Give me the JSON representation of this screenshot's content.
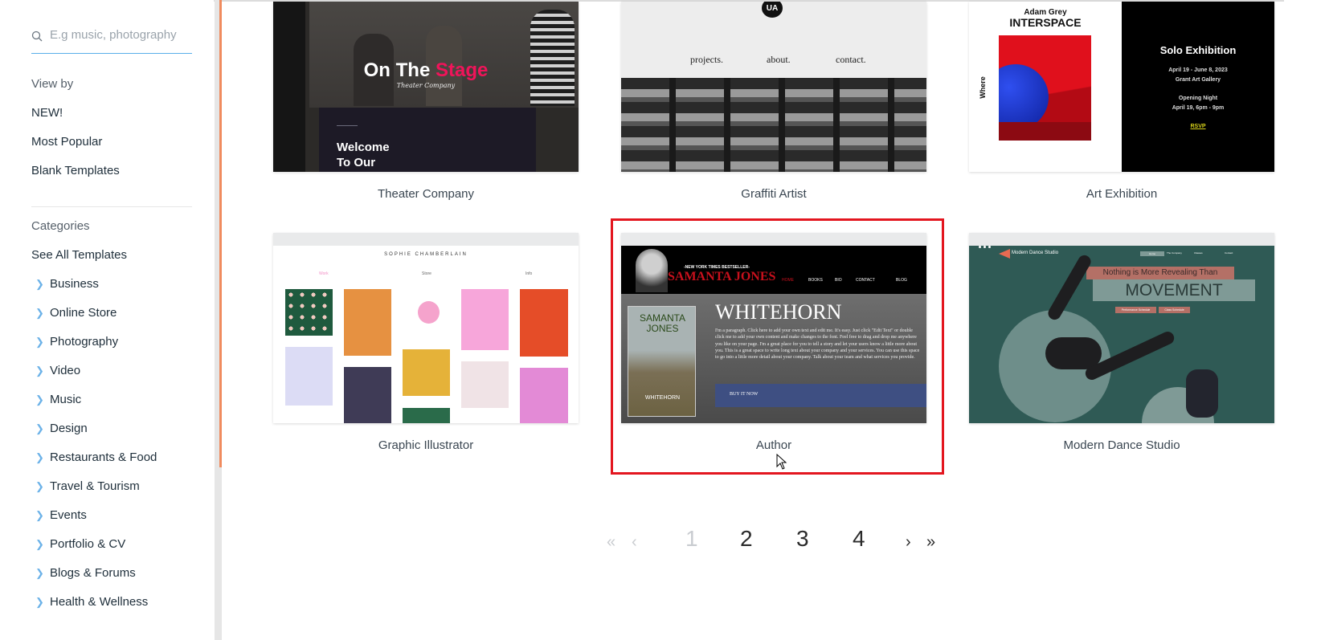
{
  "sidebar": {
    "search_placeholder": "E.g music, photography",
    "view_by_label": "View by",
    "view_by_links": [
      "NEW!",
      "Most Popular",
      "Blank Templates"
    ],
    "categories_label": "Categories",
    "see_all": "See All Templates",
    "categories": [
      "Business",
      "Online Store",
      "Photography",
      "Video",
      "Music",
      "Design",
      "Restaurants & Food",
      "Travel & Tourism",
      "Events",
      "Portfolio & CV",
      "Blogs & Forums",
      "Health & Wellness"
    ]
  },
  "templates": [
    {
      "label": "Theater Company",
      "preview": {
        "title_white": "On The",
        "title_accent": "Stage",
        "subtitle": "Theater Company",
        "welcome": "Welcome\nTo Our"
      }
    },
    {
      "label": "Graffiti Artist",
      "preview": {
        "logo": "UA",
        "nav": [
          "projects.",
          "about.",
          "contact."
        ]
      }
    },
    {
      "label": "Art Exhibition",
      "preview": {
        "artist": "Adam Grey",
        "work": "INTERSPACE",
        "side": "Where",
        "heading": "Solo Exhibition",
        "dates": "April 19 - June 8, 2023",
        "venue": "Grant Art Gallery",
        "opening": "Opening Night",
        "opening_time": "April 19, 6pm - 9pm",
        "rsvp": "RSVP"
      }
    },
    {
      "label": "Graphic Illustrator",
      "preview": {
        "name": "SOPHIE CHAMBERLAIN",
        "nav": [
          "Work",
          "Store",
          "Info"
        ]
      }
    },
    {
      "label": "Author",
      "preview": {
        "tagline": "-NEW YORK TIMES BESTSELLER-",
        "name": "SAMANTA JONES",
        "nav": [
          "HOME",
          "BOOKS",
          "BIO",
          "CONTACT",
          "BLOG"
        ],
        "book_author": "SAMANTA JONES",
        "book_title": "WHITEHORN",
        "heading": "WHITEHORN",
        "paragraph": "I'm a paragraph. Click here to add your own text and edit me. It's easy. Just click \"Edit Text\" or double click me to add your own content and make changes to the font. Feel free to drag and drop me anywhere you like on your page. I'm a great place for you to tell a story and let your users know a little more about you. This is a great space to write long text about your company and your services. You can use this space to go into a little more detail about your company. Talk about your team and what services you provide.",
        "cta": "BUY IT NOW"
      }
    },
    {
      "label": "Modern Dance Studio",
      "preview": {
        "brand": "Modern Dance Studio",
        "nav": [
          "Home",
          "The Company",
          "Classes",
          "Contact"
        ],
        "kicker": "Nothing is More Revealing Than",
        "headline": "MOVEMENT",
        "buttons": [
          "Performance Schedule",
          "Class Schedule"
        ]
      }
    }
  ],
  "selected_template": "Author",
  "pagination": {
    "first": "«",
    "prev": "‹",
    "pages": [
      "1",
      "2",
      "3",
      "4"
    ],
    "current": "1",
    "next": "›",
    "last": "»"
  },
  "colors": {
    "accent_scroll": "#f08b5e",
    "selection_border": "#e3161f",
    "search_underline": "#5aaeea",
    "chevron": "#6cb2e8"
  }
}
